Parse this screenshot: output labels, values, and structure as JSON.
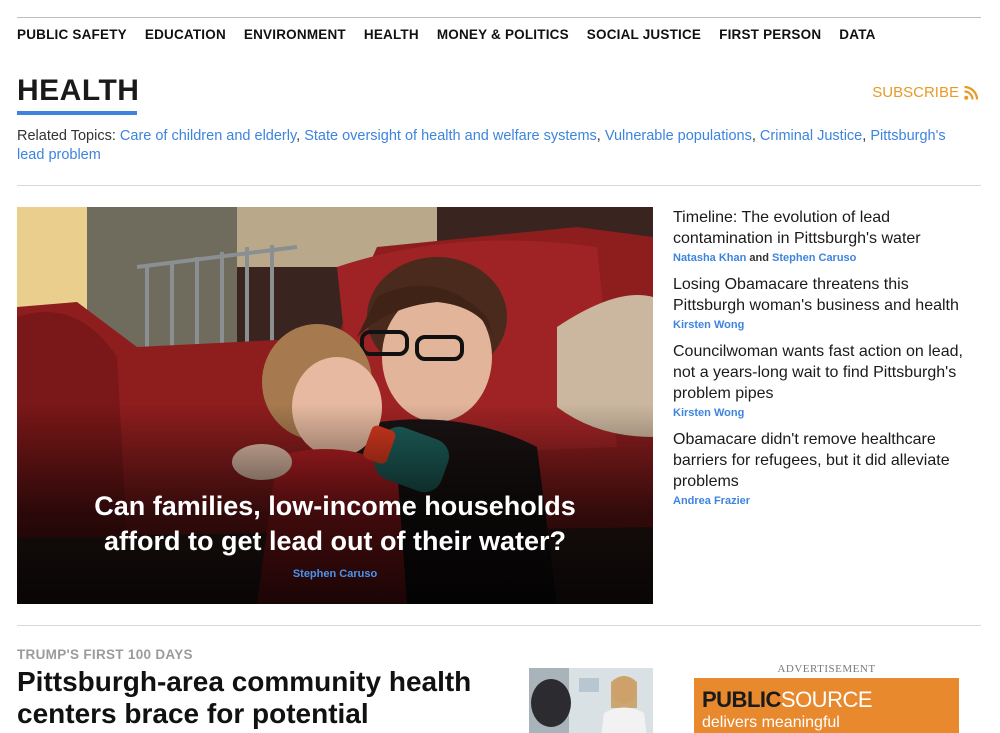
{
  "nav": {
    "items": [
      "PUBLIC SAFETY",
      "EDUCATION",
      "ENVIRONMENT",
      "HEALTH",
      "MONEY & POLITICS",
      "SOCIAL JUSTICE",
      "FIRST PERSON",
      "DATA"
    ]
  },
  "section": {
    "title": "HEALTH",
    "subscribe_label": "SUBSCRIBE"
  },
  "related": {
    "label": "Related Topics:",
    "topics": [
      "Care of children and elderly",
      "State oversight of health and welfare systems",
      "Vulnerable populations",
      "Criminal Justice",
      "Pittsburgh's lead problem"
    ]
  },
  "hero": {
    "headline_line1": "Can families, low-income households",
    "headline_line2": "afford to get lead out of their water?",
    "byline": "Stephen Caruso"
  },
  "side_stories": [
    {
      "title": "Timeline: The evolution of lead contamination in Pittsburgh's water",
      "author1": "Natasha Khan",
      "joiner": "and",
      "author2": "Stephen Caruso"
    },
    {
      "title": "Losing Obamacare threatens this Pittsburgh woman's business and health",
      "author1": "Kirsten Wong"
    },
    {
      "title": "Councilwoman wants fast action on lead, not a years-long wait to find Pittsburgh's problem pipes",
      "author1": "Kirsten Wong"
    },
    {
      "title": "Obamacare didn't remove healthcare barriers for refugees, but it did alleviate problems",
      "author1": "Andrea Frazier"
    }
  ],
  "bottom_story": {
    "kicker": "TRUMP'S FIRST 100 DAYS",
    "headline": "Pittsburgh-area community health centers brace for potential"
  },
  "ad": {
    "label": "ADVERTISEMENT",
    "brand_part1": "PUBLIC",
    "brand_part2": "SOURCE",
    "tagline": "delivers meaningful"
  },
  "colors": {
    "accent_blue": "#3d84de",
    "subscribe_orange": "#e69a27",
    "ad_orange": "#e8892e"
  },
  "icons": {
    "subscribe": "rss-icon"
  }
}
